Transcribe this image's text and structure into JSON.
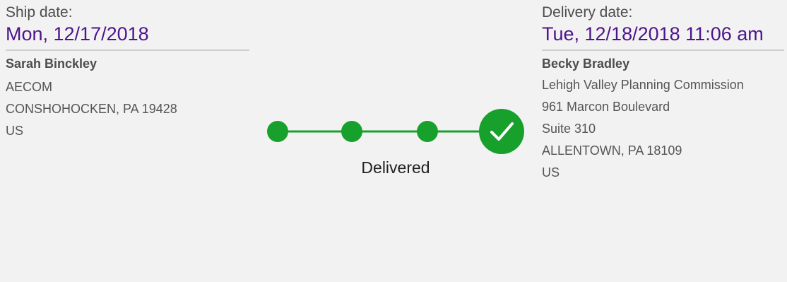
{
  "ship": {
    "label": "Ship date:",
    "date": "Mon, 12/17/2018",
    "name": "Sarah Binckley",
    "lines": [
      "AECOM",
      "CONSHOHOCKEN, PA 19428",
      "US"
    ]
  },
  "delivery": {
    "label": "Delivery date:",
    "date": "Tue, 12/18/2018 11:06 am",
    "name": "Becky Bradley",
    "lines": [
      "Lehigh Valley Planning Commission",
      "961 Marcon Boulevard",
      "Suite 310",
      "ALLENTOWN, PA 18109",
      "US"
    ]
  },
  "status": {
    "label": "Delivered",
    "steps_total": 4,
    "steps_complete": 4
  },
  "colors": {
    "accent_purple": "#4d148c",
    "progress_green": "#18a02c"
  },
  "icons": [
    "check-icon"
  ]
}
